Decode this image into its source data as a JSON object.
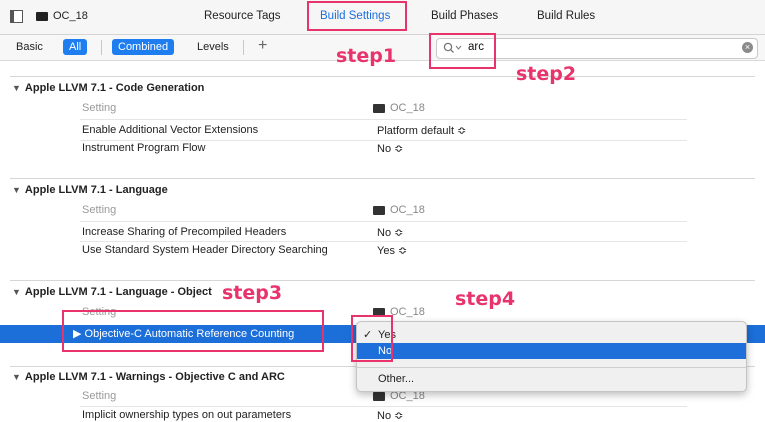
{
  "toolbar": {
    "target": "OC_18",
    "tabs": [
      "Resource Tags",
      "Build Settings",
      "Build Phases",
      "Build Rules"
    ]
  },
  "filter": {
    "buttons": [
      "Basic",
      "All",
      "Combined",
      "Levels"
    ],
    "add": "+",
    "search_value": "arc"
  },
  "sections": [
    {
      "title": "Apple LLVM 7.1 - Code Generation",
      "setting": "Setting",
      "target": "OC_18",
      "rows": [
        {
          "label": "Enable Additional Vector Extensions",
          "value": "Platform default ≎"
        },
        {
          "label": "Instrument Program Flow",
          "value": "No ≎"
        }
      ]
    },
    {
      "title": "Apple LLVM 7.1 - Language",
      "setting": "Setting",
      "target": "OC_18",
      "rows": [
        {
          "label": "Increase Sharing of Precompiled Headers",
          "value": "No ≎"
        },
        {
          "label": "Use Standard System Header Directory Searching",
          "value": "Yes ≎"
        }
      ]
    },
    {
      "title": "Apple LLVM 7.1 - Language - Object",
      "setting": "Setting",
      "target": "OC_18",
      "rows": [
        {
          "label": "Objective-C Automatic Reference Counting",
          "value": "Yes"
        }
      ]
    },
    {
      "title": "Apple LLVM 7.1 - Warnings - Objective C and ARC",
      "setting": "Setting",
      "target": "OC_18",
      "rows": [
        {
          "label": "Implicit ownership types on out parameters",
          "value": "No ≎"
        }
      ]
    }
  ],
  "popup": {
    "check": "✓",
    "options": [
      "Yes",
      "No",
      "Other..."
    ]
  },
  "annotations": [
    "step1",
    "step2",
    "step3",
    "step4"
  ],
  "colors": {
    "accent": "#1e7ef0",
    "annotation": "#e8336d",
    "selection": "#1c6ed8"
  }
}
